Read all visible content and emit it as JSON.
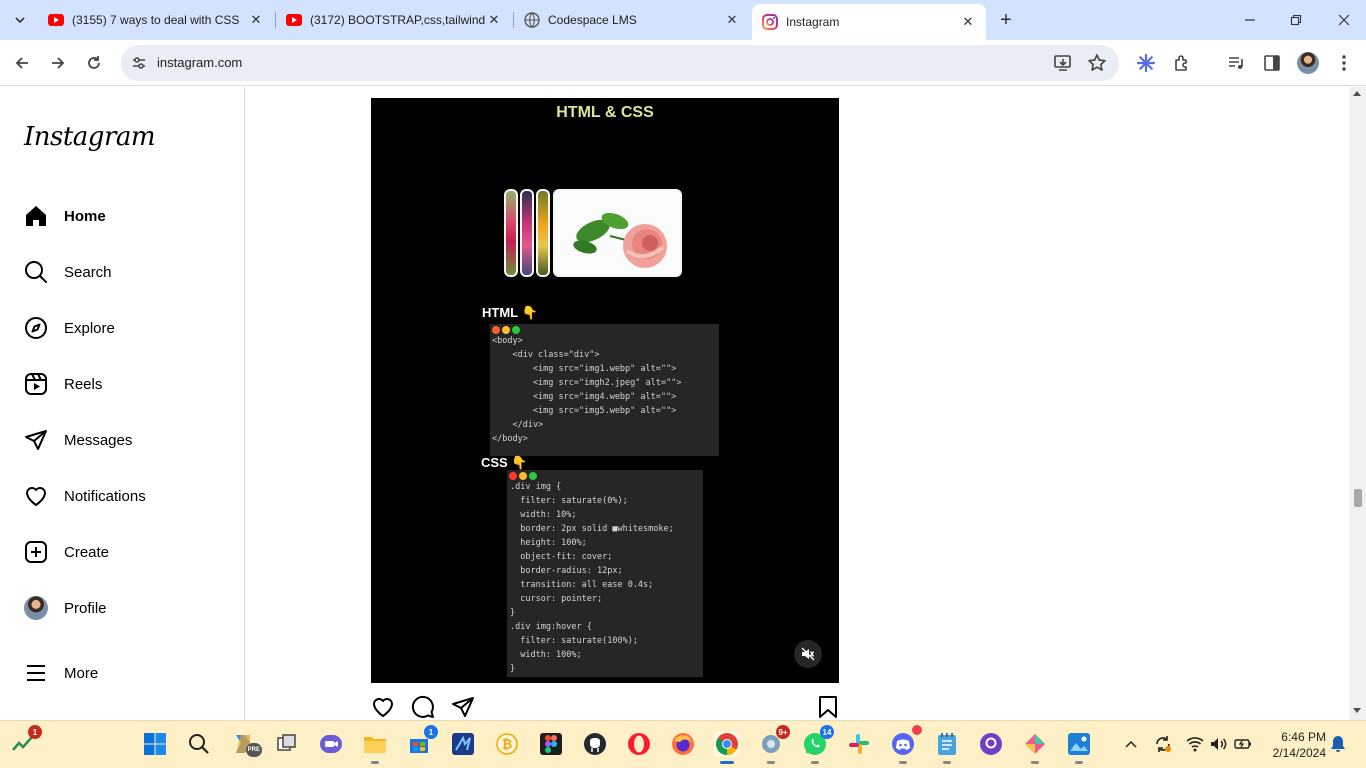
{
  "browser": {
    "tabs": [
      {
        "title": "(3155) 7 ways to deal with CSS",
        "favicon": "youtube-icon",
        "active": false
      },
      {
        "title": "(3172) BOOTSTRAP,css,tailwind",
        "favicon": "youtube-icon",
        "active": false
      },
      {
        "title": "Codespace LMS",
        "favicon": "globe-icon",
        "active": false
      },
      {
        "title": "Instagram",
        "favicon": "instagram-icon",
        "active": true
      }
    ],
    "url": "instagram.com"
  },
  "sidebar": {
    "logo": "Instagram",
    "items": [
      {
        "label": "Home",
        "icon": "home-icon",
        "active": true
      },
      {
        "label": "Search",
        "icon": "search-icon"
      },
      {
        "label": "Explore",
        "icon": "compass-icon"
      },
      {
        "label": "Reels",
        "icon": "reels-icon"
      },
      {
        "label": "Messages",
        "icon": "paper-plane-icon"
      },
      {
        "label": "Notifications",
        "icon": "heart-icon"
      },
      {
        "label": "Create",
        "icon": "plus-square-icon"
      },
      {
        "label": "Profile",
        "icon": "avatar"
      },
      {
        "label": "More",
        "icon": "hamburger-icon"
      }
    ]
  },
  "post": {
    "title": "HTML & CSS",
    "html_label": "HTML 👇",
    "css_label": "CSS 👇",
    "html_code": [
      "<body>",
      "    <div class=\"div\">",
      "        <img src=\"img1.webp\" alt=\"\">",
      "        <img src=\"imgh2.jpeg\" alt=\"\">",
      "        <img src=\"img4.webp\" alt=\"\">",
      "        <img src=\"img5.webp\" alt=\"\">",
      "    </div>",
      "</body>"
    ],
    "css_code": [
      ".div img {",
      "  filter: saturate(0%);",
      "  width: 10%;",
      "  border: 2px solid ■whitesmoke;",
      "  height: 100%;",
      "  object-fit: cover;",
      "  border-radius: 12px;",
      "  transition: all ease 0.4s;",
      "  cursor: pointer;",
      "}",
      ".div img:hover {",
      "  filter: saturate(100%);",
      "  width: 100%;",
      "}"
    ]
  },
  "taskbar": {
    "widgets_badge": "1",
    "store_badge": "1",
    "media_badge": "9+",
    "whatsapp_badge": "14",
    "time": "6:46 PM",
    "date": "2/14/2024"
  },
  "colors": {
    "tabstrip": "#d3e3fd",
    "taskbar": "#fdf0c6",
    "post_title": "#d9e69a"
  }
}
